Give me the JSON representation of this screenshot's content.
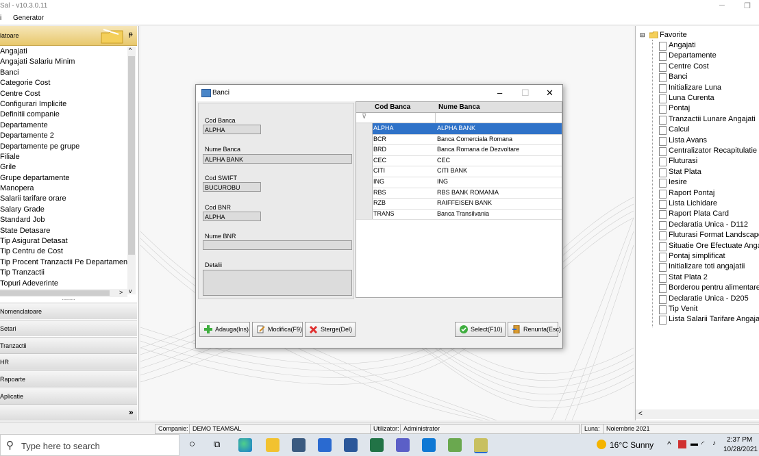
{
  "window": {
    "title": "Sal - v10.3.0.11",
    "minimize": "─",
    "maximize": "❐"
  },
  "menu": [
    "i",
    "Generator"
  ],
  "left_panel": {
    "header": "latoare",
    "pin": "ᵽ",
    "items": [
      "Angajati",
      "Angajati Salariu Minim",
      "Banci",
      "Categorie Cost",
      "Centre Cost",
      "Configurari Implicite",
      "Definitii companie",
      "Departamente",
      "Departamente 2",
      "Departamente pe grupe",
      "Filiale",
      "Grile",
      "Grupe departamente",
      "Manopera",
      "Salarii tarifare orare",
      "Salary Grade",
      "Standard Job",
      "State Detasare",
      "Tip Asigurat Detasat",
      "Tip Centru de Cost",
      "Tip Procent Tranzactii Pe Departament",
      "Tip Tranzactii",
      "Topuri Adeverinte"
    ],
    "nav": [
      "Nomenclatoare",
      "Setari",
      "Tranzactii",
      "HR",
      "Rapoarte",
      "Aplicatie"
    ],
    "splitter": "..........",
    "more": "»"
  },
  "tree": {
    "root": "Favorite",
    "items": [
      "Angajati",
      "Departamente",
      "Centre Cost",
      "Banci",
      "Initializare Luna",
      "Luna Curenta",
      "Pontaj",
      "Tranzactii Lunare Angajati",
      "Calcul",
      "Lista Avans",
      "Centralizator Recapitulatie",
      "Fluturasi",
      "Stat Plata",
      "Iesire",
      "Raport Pontaj",
      "Lista Lichidare",
      "Raport Plata Card",
      "Declaratia Unica - D112",
      "Fluturasi Format Landscape",
      "Situatie Ore Efectuate Angajati",
      "Pontaj simplificat",
      "Initializare toti angajatii",
      "Stat Plata 2",
      "Borderou pentru alimentare",
      "Declaratie Unica - D205",
      "Tip Venit",
      "Lista Salarii Tarifare Angajati"
    ]
  },
  "dialog": {
    "title": "Banci",
    "min": "–",
    "max": "☐",
    "close": "✕",
    "form": {
      "cod_banca_label": "Cod Banca",
      "cod_banca_value": "ALPHA",
      "nume_banca_label": "Nume Banca",
      "nume_banca_value": "ALPHA BANK",
      "cod_swift_label": "Cod SWIFT",
      "cod_swift_value": "BUCUROBU",
      "cod_bnr_label": "Cod BNR",
      "cod_bnr_value": "ALPHA",
      "nume_bnr_label": "Nume BNR",
      "nume_bnr_value": "",
      "detalii_label": "Detalii",
      "detalii_value": ""
    },
    "grid": {
      "columns": [
        "Cod Banca",
        "Nume Banca"
      ],
      "rows": [
        [
          "ALPHA",
          "ALPHA BANK"
        ],
        [
          "BCR",
          "Banca Comerciala Romana"
        ],
        [
          "BRD",
          "Banca Romana de Dezvoltare"
        ],
        [
          "CEC",
          "CEC"
        ],
        [
          "CITI",
          "CITI BANK"
        ],
        [
          "ING",
          "ING"
        ],
        [
          "RBS",
          "RBS BANK ROMANIA"
        ],
        [
          "RZB",
          "RAIFFEISEN BANK"
        ],
        [
          "TRANS",
          "Banca Transilvania"
        ]
      ],
      "selected_index": 0
    },
    "buttons": {
      "add": "Adauga(Ins)",
      "edit": "Modifica(F9)",
      "delete": "Sterge(Del)",
      "select": "Select(F10)",
      "cancel": "Renunta(Esc)"
    }
  },
  "status": {
    "company_label": "Companie:",
    "company_value": "DEMO TEAMSAL",
    "user_label": "Utilizator:",
    "user_value": "Administrator",
    "month_label": "Luna:",
    "month_value": "Noiembrie 2021"
  },
  "taskbar": {
    "search_placeholder": "Type here to search",
    "weather": "16°C  Sunny",
    "time": "2:37 PM",
    "date": "10/28/2021"
  },
  "colors": {
    "selection": "#2f72c8",
    "header_gold": "#e8c86c"
  }
}
